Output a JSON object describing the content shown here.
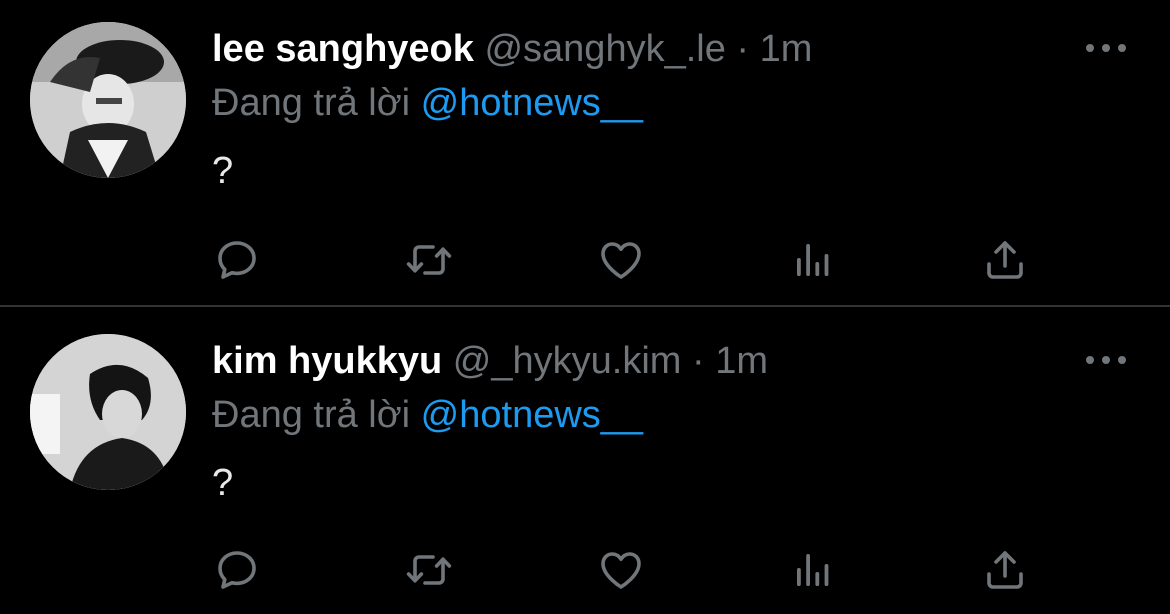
{
  "tweets": [
    {
      "display_name": "lee sanghyeok",
      "handle": "@sanghyk_.le",
      "separator": "·",
      "time": "1m",
      "replying_prefix": "Đang trả lời",
      "replying_to": "@hotnews__",
      "text": "?"
    },
    {
      "display_name": "kim hyukkyu",
      "handle": "@_hykyu.kim",
      "separator": "·",
      "time": "1m",
      "replying_prefix": "Đang trả lời",
      "replying_to": "@hotnews__",
      "text": "?"
    }
  ],
  "icons": {
    "reply": "speech-bubble-icon",
    "retweet": "retweet-arrows-icon",
    "like": "heart-icon",
    "views": "bar-chart-icon",
    "share": "share-upload-icon",
    "more": "ellipsis-icon"
  },
  "colors": {
    "background": "#000000",
    "text_primary": "#ffffff",
    "text_secondary": "#71767b",
    "mention": "#1d9bf0",
    "divider": "#2f3336"
  }
}
